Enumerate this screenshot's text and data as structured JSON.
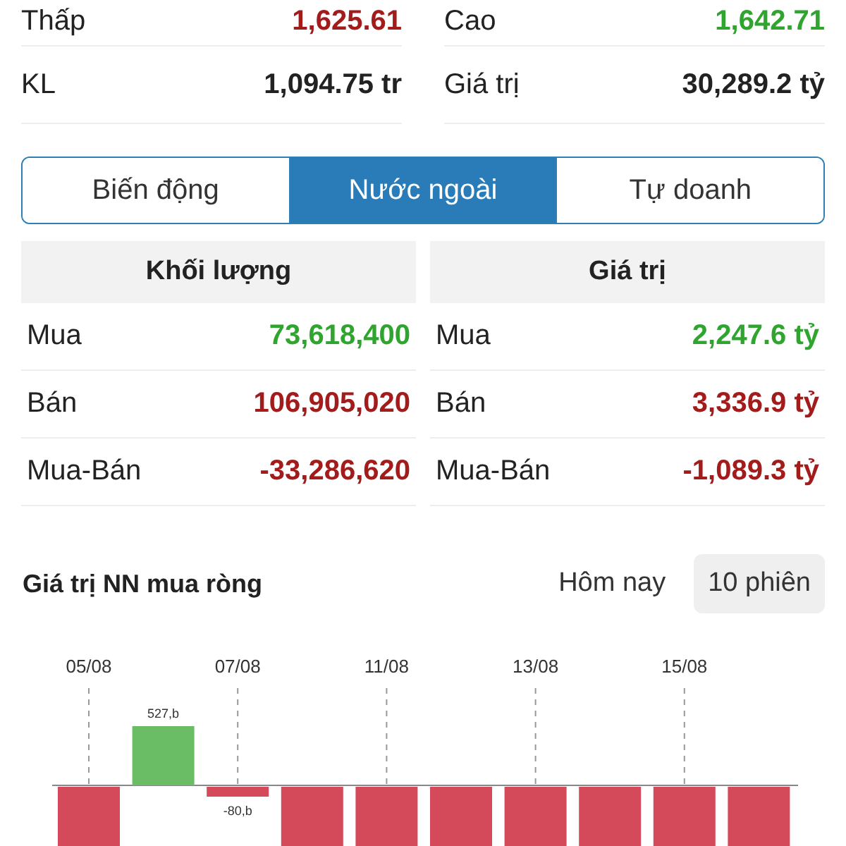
{
  "summary": [
    {
      "label": "Thấp",
      "value": "1,625.61",
      "color": "#a31c1c"
    },
    {
      "label": "Cao",
      "value": "1,642.71",
      "color": "#2fa52f"
    },
    {
      "label": "KL",
      "value": "1,094.75 tr",
      "color": "#222222"
    },
    {
      "label": "Giá trị",
      "value": "30,289.2 tỷ",
      "color": "#222222"
    }
  ],
  "tabs": [
    {
      "label": "Biến động",
      "selected": false
    },
    {
      "label": "Nước ngoài",
      "selected": true
    },
    {
      "label": "Tự doanh",
      "selected": false
    }
  ],
  "tables": [
    {
      "heading": "Khối lượng",
      "rows": [
        {
          "label": "Mua",
          "value": "73,618,400",
          "color": "#2fa52f"
        },
        {
          "label": "Bán",
          "value": "106,905,020",
          "color": "#a31c1c"
        },
        {
          "label": "Mua-Bán",
          "value": "-33,286,620",
          "color": "#a31c1c"
        }
      ]
    },
    {
      "heading": "Giá trị",
      "rows": [
        {
          "label": "Mua",
          "value": "2,247.6 tỷ",
          "color": "#2fa52f"
        },
        {
          "label": "Bán",
          "value": "3,336.9 tỷ",
          "color": "#a31c1c"
        },
        {
          "label": "Mua-Bán",
          "value": "-1,089.3 tỷ",
          "color": "#a31c1c"
        }
      ]
    }
  ],
  "chart": {
    "title": "Giá trị NN mua ròng",
    "periods": [
      {
        "label": "Hôm nay",
        "selected": false
      },
      {
        "label": "10 phiên",
        "selected": true
      }
    ],
    "bars": [
      {
        "date": "05/08",
        "color": "#d44a5a",
        "positive": false
      },
      {
        "value_label": "527,b",
        "color": "#6bbd65",
        "positive": true
      },
      {
        "date": "07/08",
        "value_label": "-80,b",
        "color": "#d44a5a",
        "positive": false
      },
      {
        "color": "#d44a5a",
        "positive": false
      },
      {
        "date": "11/08",
        "color": "#d44a5a",
        "positive": false
      },
      {
        "color": "#d44a5a",
        "positive": false
      },
      {
        "date": "13/08",
        "color": "#d44a5a",
        "positive": false
      },
      {
        "color": "#d44a5a",
        "positive": false
      },
      {
        "date": "15/08",
        "color": "#d44a5a",
        "positive": false
      },
      {
        "color": "#d44a5a",
        "positive": false
      }
    ]
  }
}
